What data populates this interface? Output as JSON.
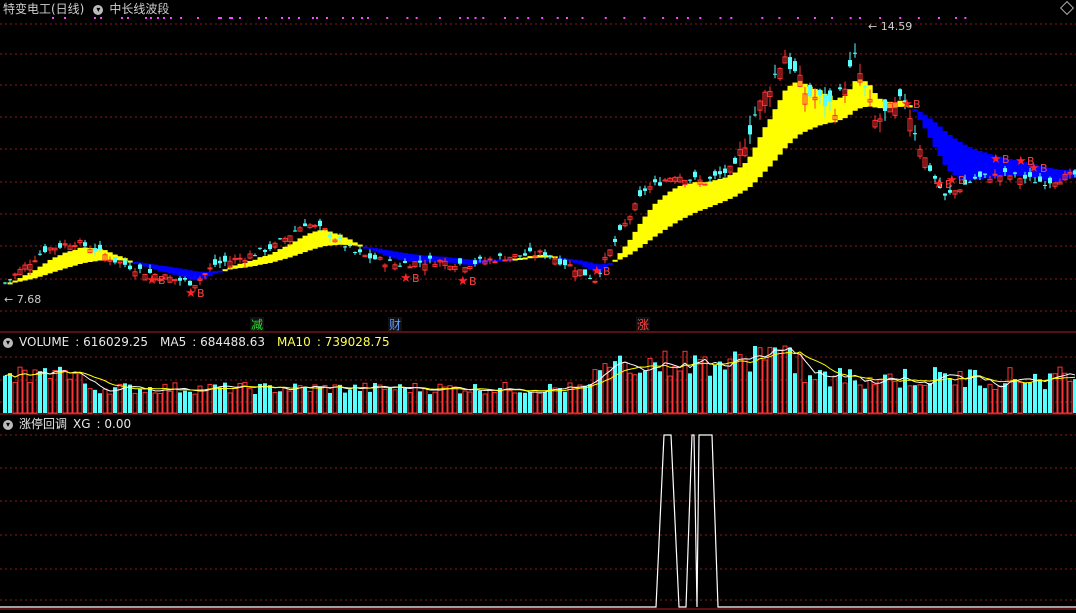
{
  "window": {
    "stock_title": "特变电工(日线)",
    "indicator_name": "中长线波段"
  },
  "price_panel": {
    "high_label": "14.59",
    "low_label": "7.68",
    "signal_letter": "B",
    "event_markers": [
      {
        "text": "减",
        "color": "#33dd33"
      },
      {
        "text": "财",
        "color": "#6699ff"
      },
      {
        "text": "涨",
        "color": "#ff4444"
      }
    ]
  },
  "volume_panel": {
    "name": "VOLUME",
    "value": "616029.25",
    "ma5_label": "MA5",
    "ma5_value": "684488.63",
    "ma10_label": "MA10",
    "ma10_value": "739028.75"
  },
  "indicator_panel": {
    "name": "涨停回调",
    "xg_label": "XG",
    "xg_value": "0.00"
  },
  "colors": {
    "up": "#ff3333",
    "down": "#55ffff",
    "band_yellow": "#ffff00",
    "band_blue": "#0000ff",
    "grid": "#8b1a1a",
    "ma5": "#ffffff",
    "ma10": "#ffff00",
    "dots": "#ff44ff"
  },
  "chart_data": [
    {
      "type": "candlestick",
      "title": "特变电工(日线)",
      "y_range": [
        7.68,
        14.59
      ],
      "labels": {
        "max": "14.59",
        "min": "7.68"
      }
    },
    {
      "type": "bar",
      "title": "VOLUME",
      "series": [
        {
          "name": "MA5",
          "last": 684488.63
        },
        {
          "name": "MA10",
          "last": 739028.75
        }
      ],
      "last_value": 616029.25
    },
    {
      "type": "line",
      "title": "涨停回调",
      "series": [
        {
          "name": "XG",
          "last": 0.0
        }
      ],
      "ylim": [
        0,
        1
      ]
    }
  ]
}
